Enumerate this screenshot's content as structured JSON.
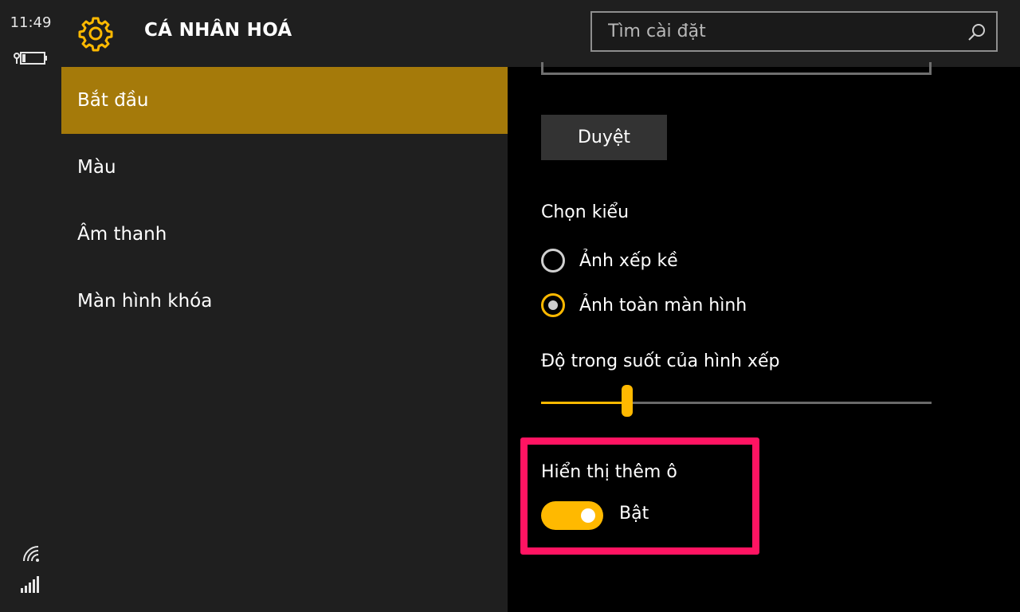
{
  "status": {
    "time": "11:49",
    "icons": [
      "battery-icon",
      "wifi-icon",
      "signal-icon"
    ]
  },
  "header": {
    "title": "CÁ NHÂN HOÁ",
    "icon": "gear-icon",
    "accent": "#ffb900"
  },
  "search": {
    "placeholder": "Tìm cài đặt",
    "icon": "search-icon"
  },
  "sidebar": {
    "items": [
      {
        "label": "Bắt đầu",
        "active": true
      },
      {
        "label": "Màu",
        "active": false
      },
      {
        "label": "Âm thanh",
        "active": false
      },
      {
        "label": "Màn hình khóa",
        "active": false
      }
    ],
    "active_color": "#a57a0a"
  },
  "content": {
    "browse_button": "Duyệt",
    "style_label": "Chọn kiểu",
    "style_options": [
      {
        "label": "Ảnh xếp kề",
        "selected": false
      },
      {
        "label": "Ảnh toàn màn hình",
        "selected": true
      }
    ],
    "transparency_label": "Độ trong suốt của hình xếp",
    "transparency_value": 0.22,
    "more_tiles_label": "Hiển thị thêm ô",
    "more_tiles_state": "Bật",
    "more_tiles_on": true,
    "highlight_color": "#ff1462"
  }
}
